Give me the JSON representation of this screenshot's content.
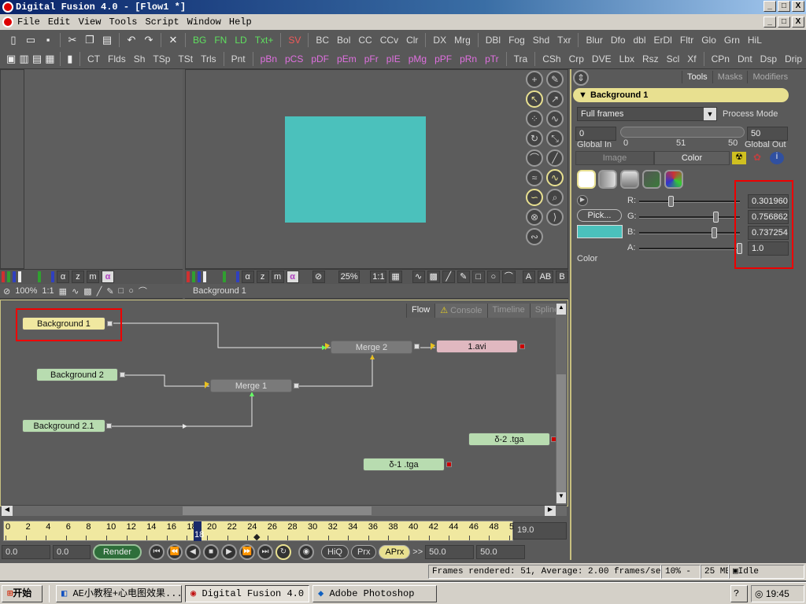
{
  "window": {
    "title": "Digital Fusion 4.0 - [Flow1 *]",
    "buttons": [
      "_",
      "□",
      "X"
    ],
    "mdi_buttons": [
      "_",
      "□",
      "X"
    ]
  },
  "menu": [
    "File",
    "Edit",
    "View",
    "Tools",
    "Script",
    "Window",
    "Help"
  ],
  "toolbar1": {
    "groupA": [
      "BG",
      "FN",
      "LD",
      "Txt+"
    ],
    "groupB": [
      "SV"
    ],
    "groupC": [
      "BC",
      "Bol",
      "CC",
      "CCv",
      "Clr"
    ],
    "groupD": [
      "DX",
      "Mrg"
    ],
    "groupE": [
      "DBl",
      "Fog",
      "Shd",
      "Txr"
    ],
    "groupF": [
      "Blur",
      "Dfo",
      "dbl",
      "ErDl",
      "Fltr",
      "Glo",
      "Grn",
      "HiL"
    ]
  },
  "toolbar2": {
    "groupA": [
      "CT",
      "Flds",
      "Sh",
      "TSp",
      "TSt",
      "Trls"
    ],
    "groupB": [
      "Pnt"
    ],
    "groupC": [
      "pBn",
      "pCS",
      "pDF",
      "pEm",
      "pFr",
      "pIE",
      "pMg",
      "pPF",
      "pRn",
      "pTr"
    ],
    "groupD": [
      "Tra"
    ],
    "groupE": [
      "CSh",
      "Crp",
      "DVE",
      "Lbx",
      "Rsz",
      "Scl",
      "Xf"
    ],
    "groupF": [
      "CPn",
      "Dnt",
      "Dsp",
      "Drip"
    ]
  },
  "viewer_left": {
    "zoom": "100%",
    "ratio": "1:1"
  },
  "viewer_right": {
    "zoom": "25%",
    "ratio": "1:1",
    "label": "Background 1"
  },
  "view_buttons": {
    "alpha": "α",
    "z": "z",
    "m": "m",
    "A": "A",
    "AB": "AB",
    "B": "B"
  },
  "colors": {
    "swatch": "#4bc1bc",
    "accent": "#e8e090"
  },
  "flow": {
    "tabs": [
      "Flow",
      "Console",
      "Timeline",
      "Spline"
    ],
    "nodes": {
      "bg1": "Background 1",
      "bg2": "Background 2",
      "bg21": "Background 2.1",
      "merge1": "Merge 1",
      "merge2": "Merge 2",
      "saver": "1.avi",
      "tga2": "δ-2 .tga",
      "tga1": "δ-1 .tga"
    }
  },
  "timeline": {
    "ticks": [
      "0",
      "2",
      "4",
      "6",
      "8",
      "10",
      "12",
      "14",
      "16",
      "18",
      "20",
      "22",
      "24",
      "26",
      "28",
      "30",
      "32",
      "34",
      "36",
      "38",
      "40",
      "42",
      "44",
      "46",
      "48",
      "50"
    ],
    "current": "18",
    "end_field": "19.0"
  },
  "transport": {
    "start": "0.0",
    "start2": "0.0",
    "render": "Render",
    "hiq": "HiQ",
    "prx": "Prx",
    "aprx": "APrx",
    "arrows": ">>",
    "end": "50.0",
    "end2": "50.0"
  },
  "panel": {
    "tabs": [
      "Tools",
      "Masks",
      "Modifiers"
    ],
    "tool_name": "Background 1",
    "process_mode_value": "Full frames",
    "process_mode_label": "Process Mode",
    "global_in_value": "0",
    "global_in_label": "Global In",
    "global_out_value": "50",
    "global_out_label": "Global Out",
    "range_ticks": [
      "0",
      "51",
      "50"
    ],
    "subtabs": [
      "Image",
      "Color"
    ],
    "pick": "Pick...",
    "channels": [
      {
        "label": "R:",
        "value": "0.3019608",
        "level": 0.3
      },
      {
        "label": "G:",
        "value": "0.7568627",
        "level": 0.76
      },
      {
        "label": "B:",
        "value": "0.7372549",
        "level": 0.74
      },
      {
        "label": "A:",
        "value": "1.0",
        "level": 1.0
      }
    ],
    "color_label": "Color"
  },
  "status": {
    "frames": "Frames rendered: 51,  Average: 2.00 frames/sec,",
    "percent": "10% -",
    "mem": "25 MB",
    "state": "Idle"
  },
  "taskbar": {
    "start": "开始",
    "items": [
      "AE小教程+心电图效果...",
      "Digital Fusion 4.0 ...",
      "Adobe Photoshop"
    ],
    "time": "19:45"
  }
}
